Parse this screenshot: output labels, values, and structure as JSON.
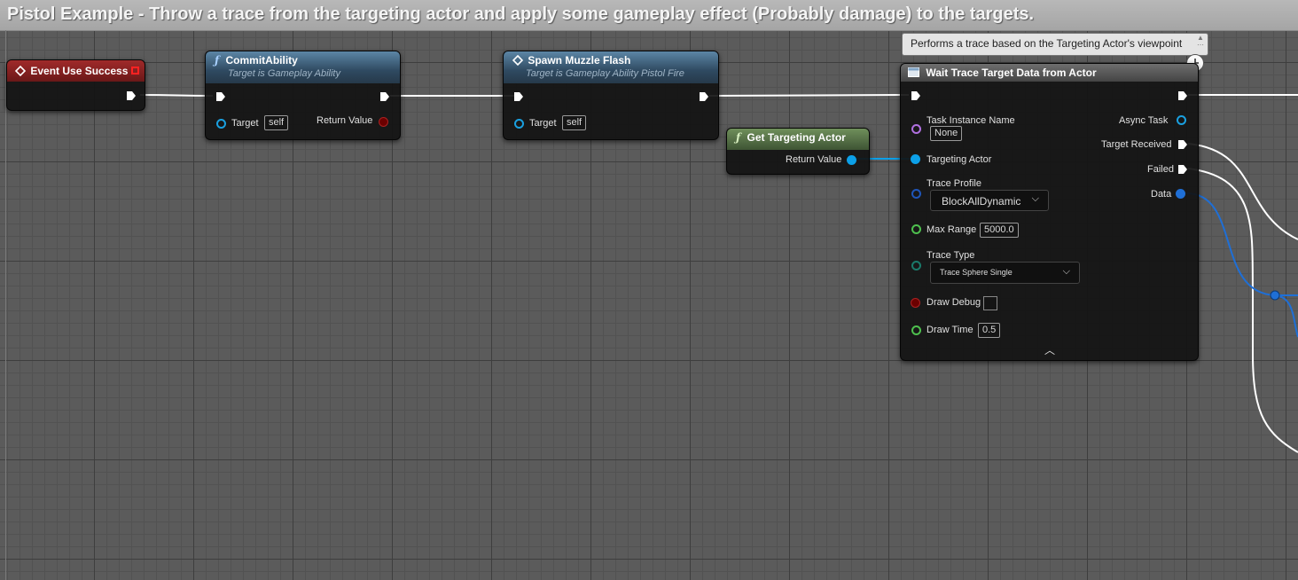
{
  "comment": {
    "title": "Pistol Example - Throw a trace from the targeting actor and apply some gameplay effect (Probably damage) to the targets."
  },
  "colors": {
    "exec_wire": "#ffffff",
    "object_wire": "#0ca0e8",
    "data_wire": "#1f6fd6",
    "event_header": "#a02a2a",
    "function_header": "#3d5f7c",
    "pure_header": "#5b7a49"
  },
  "nodes": {
    "event_use_success": {
      "title": "Event Use Success",
      "icon": "event-diamond-icon"
    },
    "commit_ability": {
      "title": "CommitAbility",
      "subtitle": "Target is Gameplay Ability",
      "icon": "function-icon",
      "target_label": "Target",
      "target_value": "self",
      "return_label": "Return Value"
    },
    "spawn_muzzle_flash": {
      "title": "Spawn Muzzle Flash",
      "subtitle": "Target is Gameplay Ability Pistol Fire",
      "icon": "event-diamond-icon",
      "target_label": "Target",
      "target_value": "self"
    },
    "get_targeting_actor": {
      "title": "Get Targeting Actor",
      "icon": "function-icon",
      "return_label": "Return Value"
    },
    "wait_trace": {
      "tooltip": "Performs a trace based on the Targeting Actor's viewpoint",
      "title": "Wait Trace Target Data from Actor",
      "task_instance_name_label": "Task Instance Name",
      "task_instance_name_value": "None",
      "targeting_actor_label": "Targeting Actor",
      "trace_profile_label": "Trace Profile",
      "trace_profile_value": "BlockAllDynamic",
      "max_range_label": "Max Range",
      "max_range_value": "5000.0",
      "trace_type_label": "Trace Type",
      "trace_type_value": "Trace Sphere Single",
      "draw_debug_label": "Draw Debug",
      "draw_debug_checked": false,
      "draw_time_label": "Draw Time",
      "draw_time_value": "0.5",
      "async_task_label": "Async Task",
      "target_received_label": "Target Received",
      "failed_label": "Failed",
      "data_label": "Data"
    }
  }
}
